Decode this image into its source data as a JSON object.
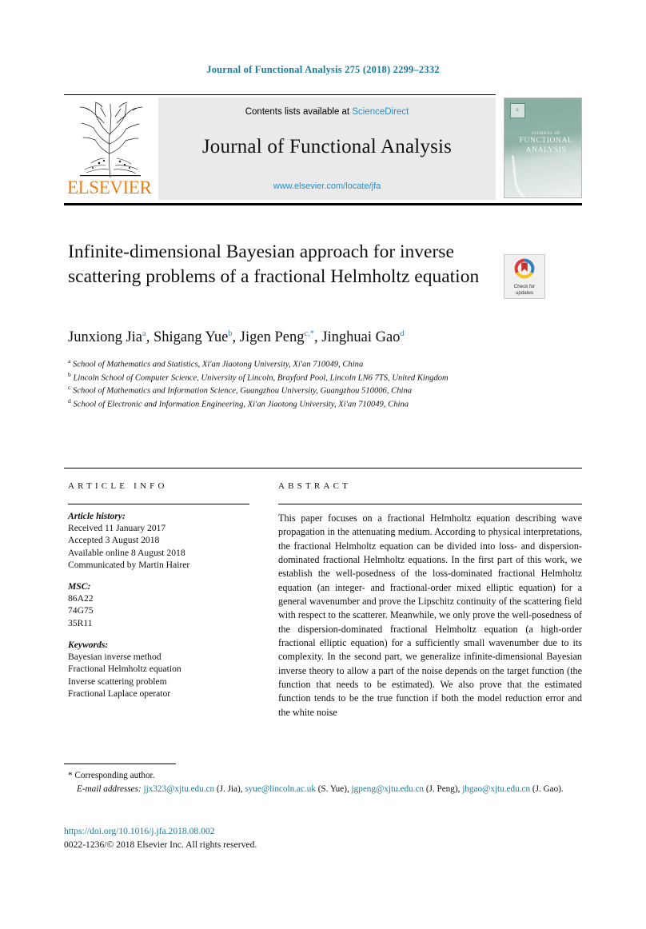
{
  "running_head": "Journal of Functional Analysis 275 (2018) 2299–2332",
  "masthead": {
    "contents_prefix": "Contents lists available at ",
    "sciencedirect": "ScienceDirect",
    "journal_name": "Journal of Functional Analysis",
    "journal_url": "www.elsevier.com/locate/jfa",
    "publisher": "ELSEVIER",
    "cover": {
      "line1": "JOURNAL OF",
      "line2": "FUNCTIONAL",
      "line3": "ANALYSIS"
    }
  },
  "article": {
    "title": "Infinite-dimensional Bayesian approach for inverse scattering problems of a fractional Helmholtz equation",
    "crossmark_line1": "Check for",
    "crossmark_line2": "updates",
    "authors_html": "Junxiong Jia<sup>a</sup>, Shigang Yue<sup>b</sup>, Jigen Peng<sup>c,*</sup>, Jinghuai Gao<sup>d</sup>",
    "affiliations": [
      {
        "marker": "a",
        "text": "School of Mathematics and Statistics, Xi'an Jiaotong University, Xi'an 710049, China"
      },
      {
        "marker": "b",
        "text": "Lincoln School of Computer Science, University of Lincoln, Brayford Pool, Lincoln LN6 7TS, United Kingdom"
      },
      {
        "marker": "c",
        "text": "School of Mathematics and Information Science, Guangzhou University, Guangzhou 510006, China"
      },
      {
        "marker": "d",
        "text": "School of Electronic and Information Engineering, Xi'an Jiaotong University, Xi'an 710049, China"
      }
    ]
  },
  "info": {
    "heading": "ARTICLE INFO",
    "history_label": "Article history:",
    "history": [
      "Received 11 January 2017",
      "Accepted 3 August 2018",
      "Available online 8 August 2018",
      "Communicated by Martin Hairer"
    ],
    "msc_label": "MSC:",
    "msc": [
      "86A22",
      "74G75",
      "35R11"
    ],
    "keywords_label": "Keywords:",
    "keywords": [
      "Bayesian inverse method",
      "Fractional Helmholtz equation",
      "Inverse scattering problem",
      "Fractional Laplace operator"
    ]
  },
  "abstract": {
    "heading": "ABSTRACT",
    "text": "This paper focuses on a fractional Helmholtz equation describing wave propagation in the attenuating medium. According to physical interpretations, the fractional Helmholtz equation can be divided into loss- and dispersion-dominated fractional Helmholtz equations. In the first part of this work, we establish the well-posedness of the loss-dominated fractional Helmholtz equation (an integer- and fractional-order mixed elliptic equation) for a general wavenumber and prove the Lipschitz continuity of the scattering field with respect to the scatterer. Meanwhile, we only prove the well-posedness of the dispersion-dominated fractional Helmholtz equation (a high-order fractional elliptic equation) for a sufficiently small wavenumber due to its complexity. In the second part, we generalize infinite-dimensional Bayesian inverse theory to allow a part of the noise depends on the target function (the function that needs to be estimated). We also prove that the estimated function tends to be the true function if both the model reduction error and the white noise"
  },
  "footer": {
    "corresponding_marker": "*",
    "corresponding_text": "Corresponding author.",
    "emails_label": "E-mail addresses:",
    "emails": [
      {
        "address": "jjx323@xjtu.edu.cn",
        "owner": "(J. Jia)"
      },
      {
        "address": "syue@lincoln.ac.uk",
        "owner": "(S. Yue)"
      },
      {
        "address": "jgpeng@xjtu.edu.cn",
        "owner": "(J. Peng)"
      },
      {
        "address": "jhgao@xjtu.edu.cn",
        "owner": "(J. Gao)"
      }
    ],
    "doi": "https://doi.org/10.1016/j.jfa.2018.08.002",
    "copyright": "0022-1236/© 2018 Elsevier Inc. All rights reserved."
  },
  "colors": {
    "link": "#1c7b9c",
    "sciencedirect": "#2b8fc4",
    "elsevier_orange": "#e8801a",
    "cover_green": "#8fb3a8"
  }
}
